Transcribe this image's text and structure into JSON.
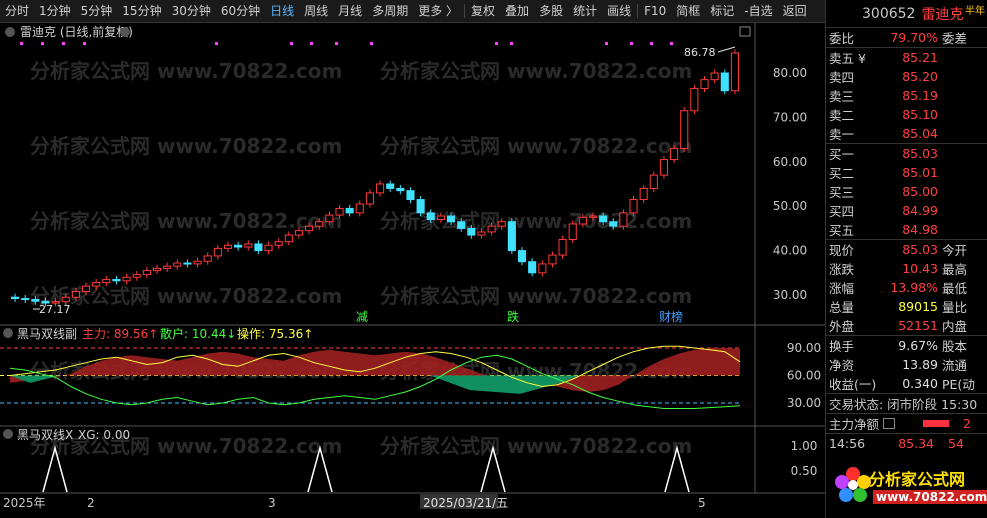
{
  "toolbar": {
    "items": [
      "分时",
      "1分钟",
      "5分钟",
      "15分钟",
      "30分钟",
      "60分钟",
      "日线",
      "周线",
      "月线",
      "多周期",
      "更多 〉",
      "复权",
      "叠加",
      "多股",
      "统计",
      "画线",
      "F10",
      "简框",
      "标记",
      "-自选",
      "返回"
    ],
    "active_index": 6
  },
  "main_chart": {
    "title": "雷迪克 (日线,前复权)",
    "y_ticks": [
      "80.00",
      "70.00",
      "60.00",
      "50.00",
      "40.00",
      "30.00"
    ],
    "high_label": "86.78",
    "low_label": "27.17",
    "markers": [
      "减",
      "跌",
      "财榜"
    ],
    "watermark": "分析家公式网 www.70822.com"
  },
  "sub1": {
    "name": "黑马双线副",
    "main_force": "主力: 89.56↑",
    "retail": "散户: 10.44↓",
    "operation": "操作: 75.36↑",
    "y_ticks": [
      "90.00",
      "60.00",
      "30.00"
    ]
  },
  "sub2": {
    "name": "黑马双线X",
    "xg": "XG: 0.00",
    "y_ticks": [
      "1.00",
      "0.50"
    ]
  },
  "x_axis": {
    "labels": [
      "2025年",
      "2",
      "3",
      "2025/03/21/五",
      "5"
    ]
  },
  "quote": {
    "code": "300652",
    "name": "雷迪克",
    "corner": "半年",
    "weibi_label": "委比",
    "weibi_value": "79.70%",
    "weicha_label": "委差",
    "asks": [
      {
        "label": "卖五 ¥",
        "price": "85.21"
      },
      {
        "label": "卖四",
        "price": "85.20"
      },
      {
        "label": "卖三",
        "price": "85.19"
      },
      {
        "label": "卖二",
        "price": "85.10"
      },
      {
        "label": "卖一",
        "price": "85.04"
      }
    ],
    "bids": [
      {
        "label": "买一",
        "price": "85.03"
      },
      {
        "label": "买二",
        "price": "85.01"
      },
      {
        "label": "买三",
        "price": "85.00"
      },
      {
        "label": "买四",
        "price": "84.99"
      },
      {
        "label": "买五",
        "price": "84.98"
      }
    ],
    "stats": [
      {
        "label": "现价",
        "value": "85.03",
        "label2": "今开",
        "color": "red"
      },
      {
        "label": "涨跌",
        "value": "10.43",
        "label2": "最高",
        "color": "red"
      },
      {
        "label": "涨幅",
        "value": "13.98%",
        "label2": "最低",
        "color": "red"
      },
      {
        "label": "总量",
        "value": "89015",
        "label2": "量比",
        "color": "yellow"
      },
      {
        "label": "外盘",
        "value": "52151",
        "label2": "内盘",
        "color": "red"
      }
    ],
    "stats2": [
      {
        "label": "换手",
        "value": "9.67%",
        "label2": "股本",
        "color": "white"
      },
      {
        "label": "净资",
        "value": "13.89",
        "label2": "流通",
        "color": "white"
      },
      {
        "label": "收益(一)",
        "value": "0.340",
        "label2": "PE(动",
        "color": "white"
      }
    ],
    "trade_status": "交易状态: 闭市阶段 15:30",
    "net_label": "主力净额",
    "net_value": "2",
    "tick_time": "14:56",
    "tick_price": "85.34",
    "tick_vol": "54",
    "logo_text": "分析家公式网",
    "logo_url": "www.70822.com"
  }
}
